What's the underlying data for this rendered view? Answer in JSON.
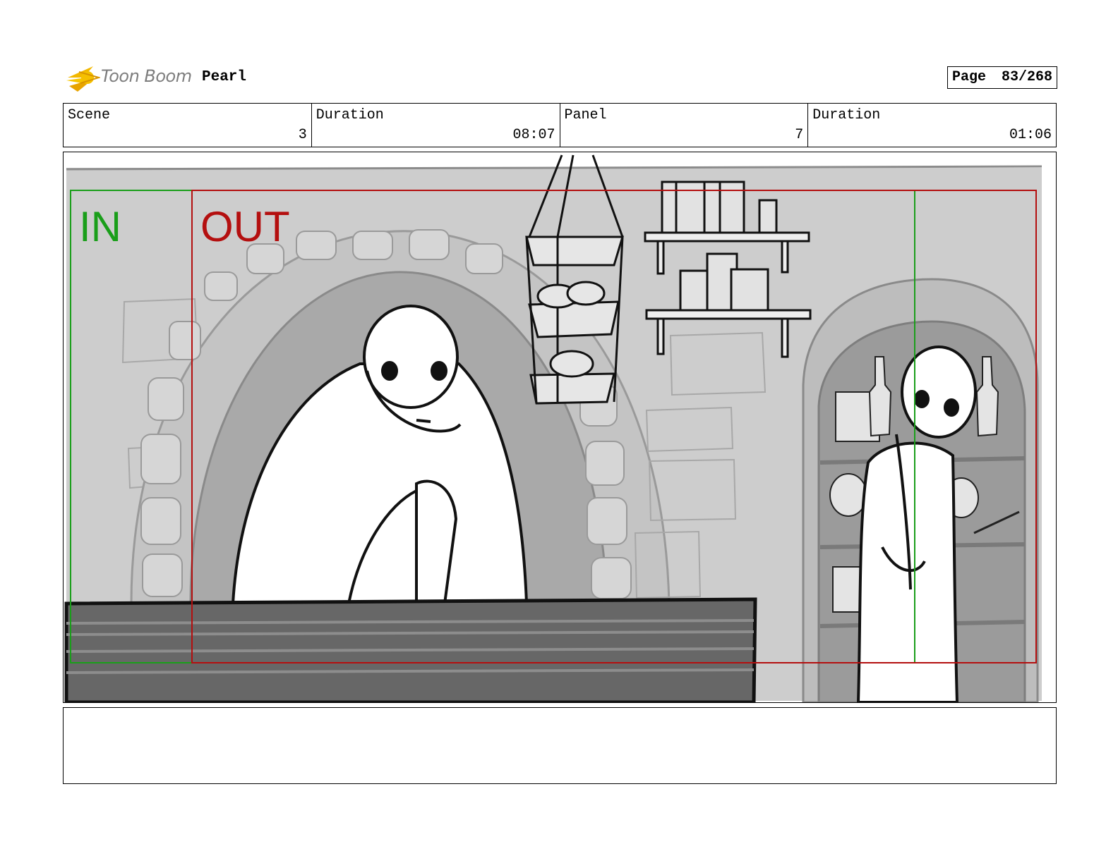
{
  "header": {
    "logo_text": "Toon Boom",
    "project_title": "Pearl",
    "page_label": "Page",
    "page_number": "83/268"
  },
  "info": {
    "scene_label": "Scene",
    "scene_value": "3",
    "scene_duration_label": "Duration",
    "scene_duration_value": "08:07",
    "panel_label": "Panel",
    "panel_value": "7",
    "panel_duration_label": "Duration",
    "panel_duration_value": "01:06"
  },
  "panel": {
    "in_label": "IN",
    "out_label": "OUT",
    "in_color": "#1a9e1a",
    "out_color": "#b40f0f"
  },
  "caption": {
    "text": ""
  }
}
